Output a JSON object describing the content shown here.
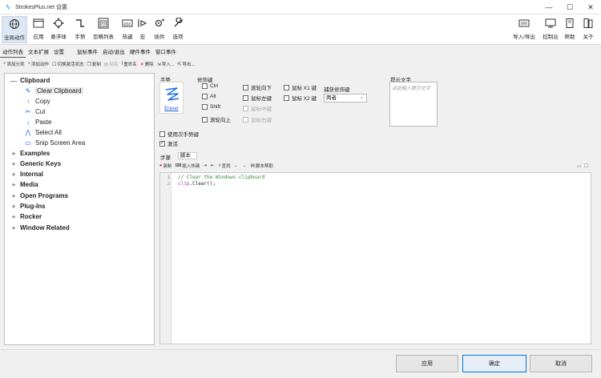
{
  "window": {
    "title": "StrokesPlus.net 设置",
    "controls": [
      "—",
      "☐",
      "✕"
    ]
  },
  "ribbon": {
    "left": [
      {
        "id": "global",
        "label": "全局动作",
        "icon": "globe-icon"
      },
      {
        "id": "app",
        "label": "应用",
        "icon": "window-icon"
      },
      {
        "id": "float",
        "label": "悬浮球",
        "icon": "gear-dots-icon"
      },
      {
        "id": "gesture",
        "label": "手势",
        "icon": "arrow-turn-icon"
      },
      {
        "id": "ignore",
        "label": "忽略列表",
        "icon": "list-window-icon"
      },
      {
        "id": "hotkey",
        "label": "热键",
        "icon": "keyboard-icon"
      },
      {
        "id": "macro",
        "label": "宏",
        "icon": "macro-icon"
      },
      {
        "id": "plugin",
        "label": "插件",
        "icon": "plugin-gear-icon"
      },
      {
        "id": "options",
        "label": "选项",
        "icon": "wrench-icon"
      }
    ],
    "right": [
      {
        "id": "import_export",
        "label": "导入/导出",
        "icon": "import-export-icon"
      },
      {
        "id": "console",
        "label": "控制台",
        "icon": "monitor-icon"
      },
      {
        "id": "help",
        "label": "帮助",
        "icon": "book-icon"
      },
      {
        "id": "about",
        "label": "关于",
        "icon": "about-icon"
      }
    ]
  },
  "tabs": [
    "动作列表",
    "文本扩展",
    "设置",
    "鼠标事件",
    "启动/退出",
    "硬件事件",
    "窗口事件"
  ],
  "toolbar": [
    {
      "label": "添加分类",
      "icon": "+"
    },
    {
      "label": "添加动作",
      "icon": "+"
    },
    {
      "label": "切换激活状态",
      "icon": "☐"
    },
    {
      "label": "复制",
      "icon": "❐"
    },
    {
      "label": "粘贴",
      "icon": "▤"
    },
    {
      "label": "重命名",
      "icon": "I"
    },
    {
      "label": "删除",
      "icon": "✕"
    },
    {
      "label": "导入...",
      "icon": "⇲"
    },
    {
      "label": "导出...",
      "icon": "⇱"
    }
  ],
  "tree": {
    "selected_category": "Clipboard",
    "actions": [
      {
        "label": "Clear Clipboard",
        "icon": "✎"
      },
      {
        "label": "Copy",
        "icon": "↑"
      },
      {
        "label": "Cut",
        "icon": "✂"
      },
      {
        "label": "Paste",
        "icon": "↓"
      },
      {
        "label": "Select All",
        "icon": "⋀"
      },
      {
        "label": "Snip Screen Area",
        "icon": "▭"
      }
    ],
    "categories": [
      "Examples",
      "Generic Keys",
      "Internal",
      "Media",
      "Open Programs",
      "Plug-Ins",
      "Rocker",
      "Window Related"
    ]
  },
  "detail": {
    "gesture_label": "手势",
    "gesture_name": "Eraser",
    "modifiers_label": "修饰键",
    "capture_label": "捕获修饰键",
    "capture_value": "两者",
    "hint_label": "提示文字",
    "hint_placeholder": "点此输入提示文字",
    "modifiers": {
      "ctrl": "Ctrl",
      "alt": "Alt",
      "shift": "Shift",
      "wheel_up": "滚轮向上",
      "wheel_down": "滚轮向下",
      "left": "鼠标左键",
      "middle": "鼠标中键",
      "right": "鼠标右键",
      "x1": "鼠标 X1 键",
      "x2": "鼠标 X2 键"
    },
    "secondary_label": "使用次手势键",
    "active_label": "激活",
    "active_checked": "✓",
    "steps_label": "步骤",
    "steps_value": "脚本"
  },
  "script_toolbar": [
    {
      "label": "录制",
      "icon": "●"
    },
    {
      "label": "插入热键",
      "icon": "⌨"
    },
    {
      "label": "",
      "icon": "⇥"
    },
    {
      "label": "",
      "icon": "⇤"
    },
    {
      "label": "查找",
      "icon": "⌕"
    },
    {
      "label": "",
      "icon": "←"
    },
    {
      "label": "",
      "icon": "→"
    },
    {
      "label": "脚本帮助",
      "icon": "▤"
    }
  ],
  "code": {
    "lines": [
      "1",
      "2"
    ],
    "comment": "// Clear the Windows clipboard",
    "obj": "clip",
    "call": ".Clear();"
  },
  "footer": {
    "apply": "应用",
    "ok": "确定",
    "cancel": "取消"
  }
}
